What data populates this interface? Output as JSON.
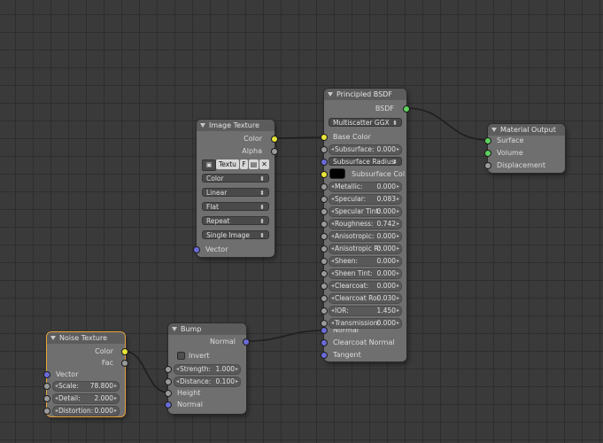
{
  "nodes": {
    "principled": {
      "title": "Principled BSDF",
      "out_bsdf": "BSDF",
      "distribution": "Multiscatter GGX",
      "base_color": "Base Color",
      "subsurface": {
        "label": "Subsurface:",
        "value": "0.000"
      },
      "subsurface_method": "Subsurface Radius",
      "subsurface_color": "Subsurface Col",
      "fields": [
        {
          "label": "Metallic:",
          "value": "0.000"
        },
        {
          "label": "Specular:",
          "value": "0.083"
        },
        {
          "label": "Specular Tint:",
          "value": "0.000"
        },
        {
          "label": "Roughness:",
          "value": "0.742"
        },
        {
          "label": "Anisotropic:",
          "value": "0.000"
        },
        {
          "label": "Anisotropic R:",
          "value": "0.000"
        },
        {
          "label": "Sheen:",
          "value": "0.000"
        },
        {
          "label": "Sheen Tint:",
          "value": "0.000"
        },
        {
          "label": "Clearcoat:",
          "value": "0.000"
        },
        {
          "label": "Clearcoat Ro:",
          "value": "0.030"
        },
        {
          "label": "IOR:",
          "value": "1.450"
        },
        {
          "label": "Transmission:",
          "value": "0.000"
        }
      ],
      "normal": "Normal",
      "clearcoat_normal": "Clearcoat Normal",
      "tangent": "Tangent"
    },
    "material_output": {
      "title": "Material Output",
      "surface": "Surface",
      "volume": "Volume",
      "displacement": "Displacement"
    },
    "image_texture": {
      "title": "Image Texture",
      "out_color": "Color",
      "out_alpha": "Alpha",
      "image_name": "Textu",
      "fake_user": "F",
      "color_space": "Color",
      "interpolation": "Linear",
      "projection": "Flat",
      "extension": "Repeat",
      "source": "Single Image",
      "vector": "Vector"
    },
    "bump": {
      "title": "Bump",
      "out_normal": "Normal",
      "invert": "Invert",
      "strength": {
        "label": "Strength:",
        "value": "1.000"
      },
      "distance": {
        "label": "Distance:",
        "value": "0.100"
      },
      "height": "Height",
      "normal": "Normal"
    },
    "noise": {
      "title": "Noise Texture",
      "out_color": "Color",
      "out_fac": "Fac",
      "vector": "Vector",
      "scale": {
        "label": "Scale:",
        "value": "78.800"
      },
      "detail": {
        "label": "Detail:",
        "value": "2.000"
      },
      "distortion": {
        "label": "Distortion:",
        "value": "0.000"
      }
    }
  },
  "colors": {
    "color_socket": "#e8e33a",
    "float_socket": "#9a9a9a",
    "shader_socket": "#5ed35e",
    "vector_socket": "#6a6ad8",
    "active_outline": "#e8a23a"
  }
}
